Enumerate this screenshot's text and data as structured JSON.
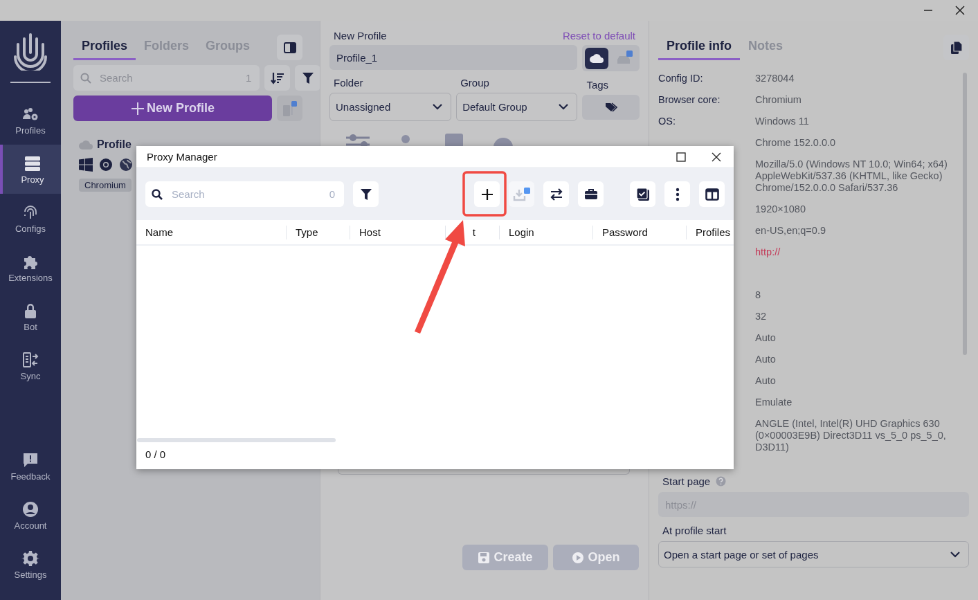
{
  "sidebar": {
    "items": [
      {
        "kind": "profiles",
        "label": "Profiles",
        "selected": false
      },
      {
        "kind": "proxy",
        "label": "Proxy",
        "selected": true
      },
      {
        "kind": "configs",
        "label": "Configs",
        "selected": false
      },
      {
        "kind": "extensions",
        "label": "Extensions",
        "selected": false
      },
      {
        "kind": "bot",
        "label": "Bot",
        "selected": false
      },
      {
        "kind": "sync",
        "label": "Sync",
        "selected": false
      }
    ],
    "bottom_items": [
      {
        "kind": "feedback",
        "label": "Feedback",
        "selected": false
      },
      {
        "kind": "account",
        "label": "Account",
        "selected": false
      },
      {
        "kind": "settings",
        "label": "Settings",
        "selected": false
      }
    ]
  },
  "profiles_panel": {
    "tabs": [
      {
        "label": "Profiles",
        "selected": true
      },
      {
        "label": "Folders",
        "selected": false
      },
      {
        "label": "Groups",
        "selected": false
      }
    ],
    "search": {
      "placeholder": "Search",
      "count": "1"
    },
    "new_button": "New Profile",
    "profile": {
      "name": "Profile",
      "tag": "Chromium"
    }
  },
  "new_profile": {
    "title": "New Profile",
    "reset": "Reset to default",
    "name_value": "Profile_1",
    "storage": [
      {
        "kind": "cloud",
        "selected": true
      },
      {
        "kind": "local",
        "selected": false
      }
    ],
    "folder": {
      "label": "Folder",
      "value": "Unassigned"
    },
    "group": {
      "label": "Group",
      "value": "Default Group"
    },
    "tags": {
      "label": "Tags"
    },
    "buttons": [
      {
        "kind": "create",
        "label": "Create",
        "disabled": true
      },
      {
        "kind": "open",
        "label": "Open",
        "disabled": true
      }
    ]
  },
  "profile_info": {
    "tabs": [
      {
        "label": "Profile info",
        "selected": true
      },
      {
        "label": "Notes",
        "selected": false
      }
    ],
    "rows": [
      {
        "label": "Config ID:",
        "value": "3278044"
      },
      {
        "label": "Browser core:",
        "value": "Chromium"
      },
      {
        "label": "OS:",
        "value": "Windows 11"
      },
      {
        "value": "Chrome 152.0.0.0"
      },
      {
        "value": "Mozilla/5.0 (Windows NT 10.0; Win64; x64) AppleWebKit/537.36 (KHTML, like Gecko) Chrome/152.0.0.0 Safari/537.36"
      },
      {
        "value": "1920×1080"
      },
      {
        "value": "en-US,en;q=0.9"
      },
      {
        "kind": "proxy",
        "value": "http://"
      },
      {
        "value": "8"
      },
      {
        "value": "32"
      },
      {
        "value": "Auto"
      },
      {
        "value": "Auto"
      },
      {
        "value": "Auto"
      },
      {
        "value": "Emulate"
      },
      {
        "value": "ANGLE (Intel, Intel(R) UHD Graphics 630 (0×00003E9B) Direct3D11 vs_5_0 ps_5_0, D3D11)"
      }
    ],
    "start_page": {
      "label": "Start page",
      "placeholder": "https://"
    },
    "at_start": {
      "label": "At profile start",
      "value": "Open a start page or set of pages"
    }
  },
  "proxy_manager": {
    "title": "Proxy Manager",
    "search": {
      "placeholder": "Search",
      "count": "0"
    },
    "toolbar": [
      [
        {
          "kind": "add",
          "disabled": false
        },
        {
          "kind": "import",
          "disabled": true
        },
        {
          "kind": "swap",
          "disabled": false
        },
        {
          "kind": "briefcase",
          "disabled": false
        }
      ],
      [
        {
          "kind": "check",
          "disabled": false
        },
        {
          "kind": "more",
          "disabled": false
        },
        {
          "kind": "columns",
          "disabled": false
        }
      ]
    ],
    "columns": [
      "Name",
      "Type",
      "Host",
      "t",
      "Login",
      "Password",
      "Profiles"
    ],
    "footer": "0 / 0"
  }
}
